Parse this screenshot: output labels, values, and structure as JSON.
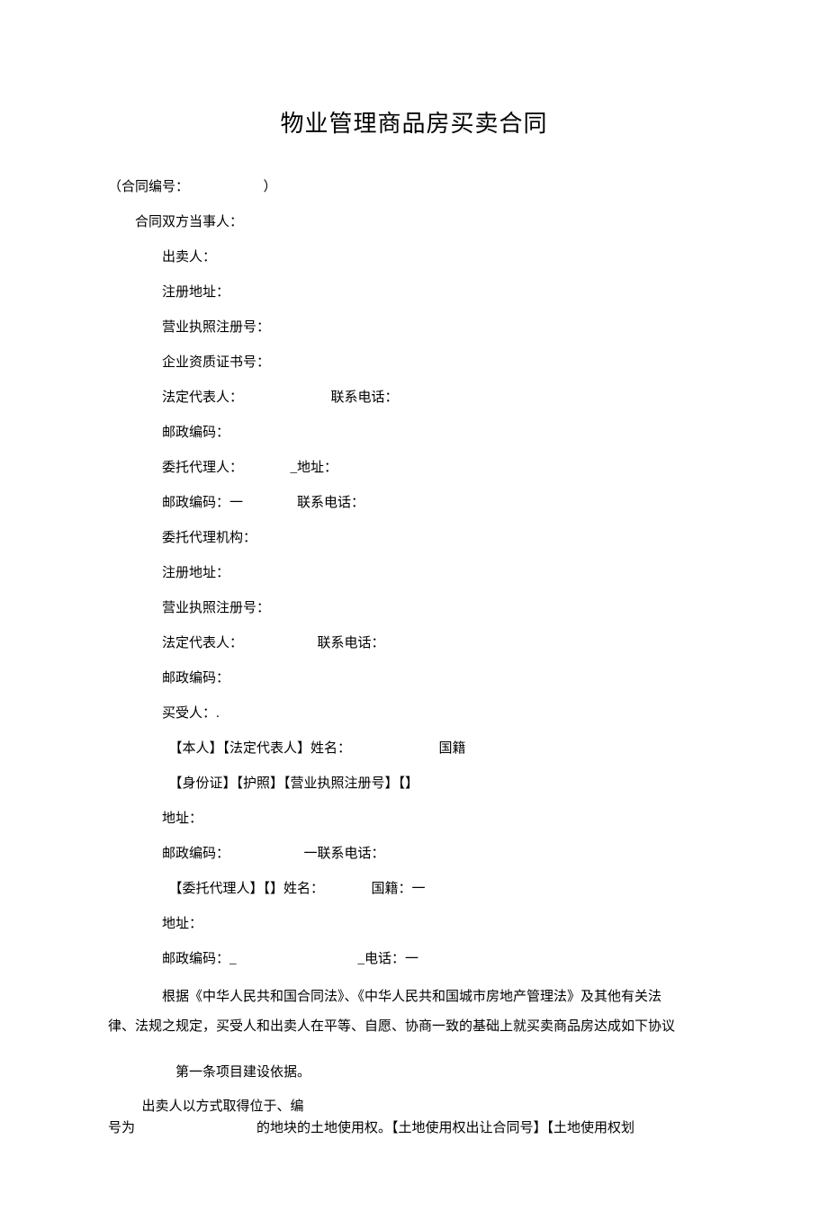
{
  "title": "物业管理商品房买卖合同",
  "contract_no": "（合同编号：　　　　　　）",
  "parties_heading": "合同双方当事人：",
  "seller": {
    "label": "出卖人：",
    "reg_addr": "注册地址：",
    "license_no": "营业执照注册号：",
    "qualification_no": "企业资质证书号：",
    "legal_rep": "法定代表人：　　　　　　　联系电话：",
    "postcode": "邮政编码：",
    "agent": "委托代理人：　　　　_地址：",
    "agent_post_tel": "邮政编码：一　　　　联系电话：",
    "agent_org": "委托代理机构：",
    "agent_reg_addr": "注册地址：",
    "agent_license": "营业执照注册号：",
    "agent_legal_rep": "法定代表人：　　　　　　联系电话：",
    "agent_postcode": "邮政编码："
  },
  "buyer": {
    "label": "买受人：.",
    "name": "【本人】【法定代表人】姓名：　　　　　　　国籍",
    "id": "【身份证】【护照】【营业执照注册号】【】",
    "addr": "地址：",
    "post_tel": "邮政编码：　　　　　　一联系电话：",
    "agent_name": "【委托代理人】【】姓名：　　　　国籍：一",
    "agent_addr": "地址：",
    "agent_post_tel": "邮政编码：_　　　　　　　　　_电话：一"
  },
  "basis_para": "根据《中华人民共和国合同法》、《中华人民共和国城市房地产管理法》及其他有关法律、法规之定，买受人和出卖人在平等、自愿、协商一致的基础上就买卖商品房达成如下协议",
  "article1": "第一条项目建设依据。",
  "last_l1": "出卖人以方式取得位于、编",
  "last_l2": "号为　　　　　　　　　的地块的土地使用权。【土地使用权出让合同号】【土地使用权划"
}
